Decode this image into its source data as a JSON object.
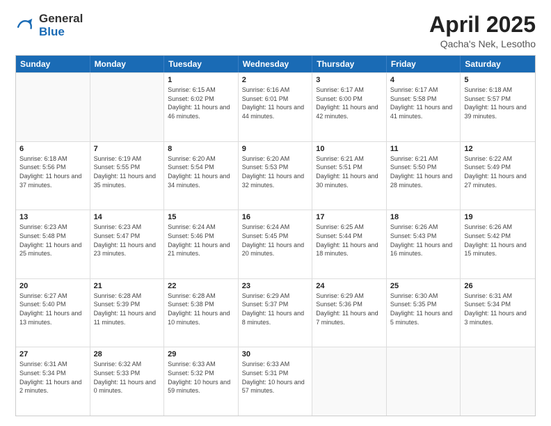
{
  "logo": {
    "general": "General",
    "blue": "Blue"
  },
  "title": "April 2025",
  "subtitle": "Qacha's Nek, Lesotho",
  "header_days": [
    "Sunday",
    "Monday",
    "Tuesday",
    "Wednesday",
    "Thursday",
    "Friday",
    "Saturday"
  ],
  "weeks": [
    [
      {
        "day": "",
        "sunrise": "",
        "sunset": "",
        "daylight": ""
      },
      {
        "day": "",
        "sunrise": "",
        "sunset": "",
        "daylight": ""
      },
      {
        "day": "1",
        "sunrise": "Sunrise: 6:15 AM",
        "sunset": "Sunset: 6:02 PM",
        "daylight": "Daylight: 11 hours and 46 minutes."
      },
      {
        "day": "2",
        "sunrise": "Sunrise: 6:16 AM",
        "sunset": "Sunset: 6:01 PM",
        "daylight": "Daylight: 11 hours and 44 minutes."
      },
      {
        "day": "3",
        "sunrise": "Sunrise: 6:17 AM",
        "sunset": "Sunset: 6:00 PM",
        "daylight": "Daylight: 11 hours and 42 minutes."
      },
      {
        "day": "4",
        "sunrise": "Sunrise: 6:17 AM",
        "sunset": "Sunset: 5:58 PM",
        "daylight": "Daylight: 11 hours and 41 minutes."
      },
      {
        "day": "5",
        "sunrise": "Sunrise: 6:18 AM",
        "sunset": "Sunset: 5:57 PM",
        "daylight": "Daylight: 11 hours and 39 minutes."
      }
    ],
    [
      {
        "day": "6",
        "sunrise": "Sunrise: 6:18 AM",
        "sunset": "Sunset: 5:56 PM",
        "daylight": "Daylight: 11 hours and 37 minutes."
      },
      {
        "day": "7",
        "sunrise": "Sunrise: 6:19 AM",
        "sunset": "Sunset: 5:55 PM",
        "daylight": "Daylight: 11 hours and 35 minutes."
      },
      {
        "day": "8",
        "sunrise": "Sunrise: 6:20 AM",
        "sunset": "Sunset: 5:54 PM",
        "daylight": "Daylight: 11 hours and 34 minutes."
      },
      {
        "day": "9",
        "sunrise": "Sunrise: 6:20 AM",
        "sunset": "Sunset: 5:53 PM",
        "daylight": "Daylight: 11 hours and 32 minutes."
      },
      {
        "day": "10",
        "sunrise": "Sunrise: 6:21 AM",
        "sunset": "Sunset: 5:51 PM",
        "daylight": "Daylight: 11 hours and 30 minutes."
      },
      {
        "day": "11",
        "sunrise": "Sunrise: 6:21 AM",
        "sunset": "Sunset: 5:50 PM",
        "daylight": "Daylight: 11 hours and 28 minutes."
      },
      {
        "day": "12",
        "sunrise": "Sunrise: 6:22 AM",
        "sunset": "Sunset: 5:49 PM",
        "daylight": "Daylight: 11 hours and 27 minutes."
      }
    ],
    [
      {
        "day": "13",
        "sunrise": "Sunrise: 6:23 AM",
        "sunset": "Sunset: 5:48 PM",
        "daylight": "Daylight: 11 hours and 25 minutes."
      },
      {
        "day": "14",
        "sunrise": "Sunrise: 6:23 AM",
        "sunset": "Sunset: 5:47 PM",
        "daylight": "Daylight: 11 hours and 23 minutes."
      },
      {
        "day": "15",
        "sunrise": "Sunrise: 6:24 AM",
        "sunset": "Sunset: 5:46 PM",
        "daylight": "Daylight: 11 hours and 21 minutes."
      },
      {
        "day": "16",
        "sunrise": "Sunrise: 6:24 AM",
        "sunset": "Sunset: 5:45 PM",
        "daylight": "Daylight: 11 hours and 20 minutes."
      },
      {
        "day": "17",
        "sunrise": "Sunrise: 6:25 AM",
        "sunset": "Sunset: 5:44 PM",
        "daylight": "Daylight: 11 hours and 18 minutes."
      },
      {
        "day": "18",
        "sunrise": "Sunrise: 6:26 AM",
        "sunset": "Sunset: 5:43 PM",
        "daylight": "Daylight: 11 hours and 16 minutes."
      },
      {
        "day": "19",
        "sunrise": "Sunrise: 6:26 AM",
        "sunset": "Sunset: 5:42 PM",
        "daylight": "Daylight: 11 hours and 15 minutes."
      }
    ],
    [
      {
        "day": "20",
        "sunrise": "Sunrise: 6:27 AM",
        "sunset": "Sunset: 5:40 PM",
        "daylight": "Daylight: 11 hours and 13 minutes."
      },
      {
        "day": "21",
        "sunrise": "Sunrise: 6:28 AM",
        "sunset": "Sunset: 5:39 PM",
        "daylight": "Daylight: 11 hours and 11 minutes."
      },
      {
        "day": "22",
        "sunrise": "Sunrise: 6:28 AM",
        "sunset": "Sunset: 5:38 PM",
        "daylight": "Daylight: 11 hours and 10 minutes."
      },
      {
        "day": "23",
        "sunrise": "Sunrise: 6:29 AM",
        "sunset": "Sunset: 5:37 PM",
        "daylight": "Daylight: 11 hours and 8 minutes."
      },
      {
        "day": "24",
        "sunrise": "Sunrise: 6:29 AM",
        "sunset": "Sunset: 5:36 PM",
        "daylight": "Daylight: 11 hours and 7 minutes."
      },
      {
        "day": "25",
        "sunrise": "Sunrise: 6:30 AM",
        "sunset": "Sunset: 5:35 PM",
        "daylight": "Daylight: 11 hours and 5 minutes."
      },
      {
        "day": "26",
        "sunrise": "Sunrise: 6:31 AM",
        "sunset": "Sunset: 5:34 PM",
        "daylight": "Daylight: 11 hours and 3 minutes."
      }
    ],
    [
      {
        "day": "27",
        "sunrise": "Sunrise: 6:31 AM",
        "sunset": "Sunset: 5:34 PM",
        "daylight": "Daylight: 11 hours and 2 minutes."
      },
      {
        "day": "28",
        "sunrise": "Sunrise: 6:32 AM",
        "sunset": "Sunset: 5:33 PM",
        "daylight": "Daylight: 11 hours and 0 minutes."
      },
      {
        "day": "29",
        "sunrise": "Sunrise: 6:33 AM",
        "sunset": "Sunset: 5:32 PM",
        "daylight": "Daylight: 10 hours and 59 minutes."
      },
      {
        "day": "30",
        "sunrise": "Sunrise: 6:33 AM",
        "sunset": "Sunset: 5:31 PM",
        "daylight": "Daylight: 10 hours and 57 minutes."
      },
      {
        "day": "",
        "sunrise": "",
        "sunset": "",
        "daylight": ""
      },
      {
        "day": "",
        "sunrise": "",
        "sunset": "",
        "daylight": ""
      },
      {
        "day": "",
        "sunrise": "",
        "sunset": "",
        "daylight": ""
      }
    ]
  ]
}
